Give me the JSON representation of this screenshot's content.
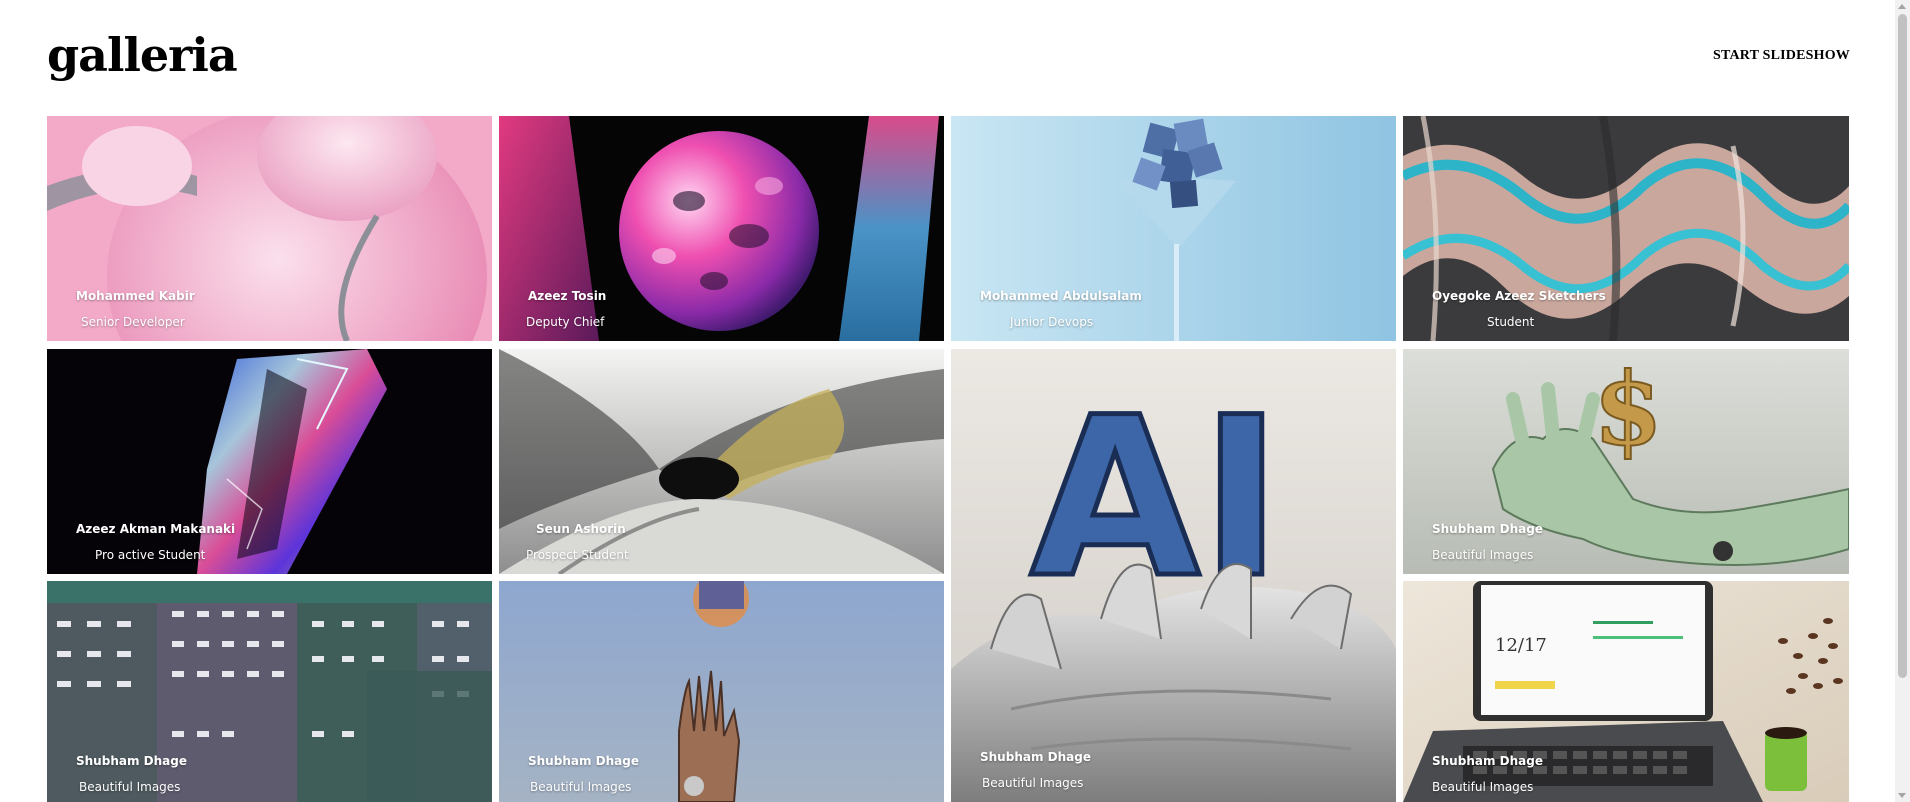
{
  "header": {
    "logo": "galleria",
    "slideshow_label": "START SLIDESHOW"
  },
  "cards": [
    {
      "name": "Mohammed Kabir",
      "role": "Senior Developer"
    },
    {
      "name": "Azeez Tosin",
      "role": "Deputy Chief"
    },
    {
      "name": "Mohammed Abdulsalam",
      "role": "Junior Devops"
    },
    {
      "name": "Oyegoke Azeez Sketchers",
      "role": "Student"
    },
    {
      "name": "Azeez Akman Makanaki",
      "role": "Pro active Student"
    },
    {
      "name": "Seun Ashorin",
      "role": "Prospect Student"
    },
    {
      "name": "Shubham Dhage",
      "role": "Beautiful Images"
    },
    {
      "name": "Shubham Dhage",
      "role": "Beautiful Images"
    },
    {
      "name": "Shubham Dhage",
      "role": "Beautiful Images"
    },
    {
      "name": "Shubham Dhage",
      "role": "Beautiful Images"
    },
    {
      "name": "Shubham Dhage",
      "role": "Beautiful Images"
    }
  ],
  "artwork_text": {
    "ai_letters": "AI",
    "dollar_sign": "$",
    "laptop_number": "12/17"
  }
}
